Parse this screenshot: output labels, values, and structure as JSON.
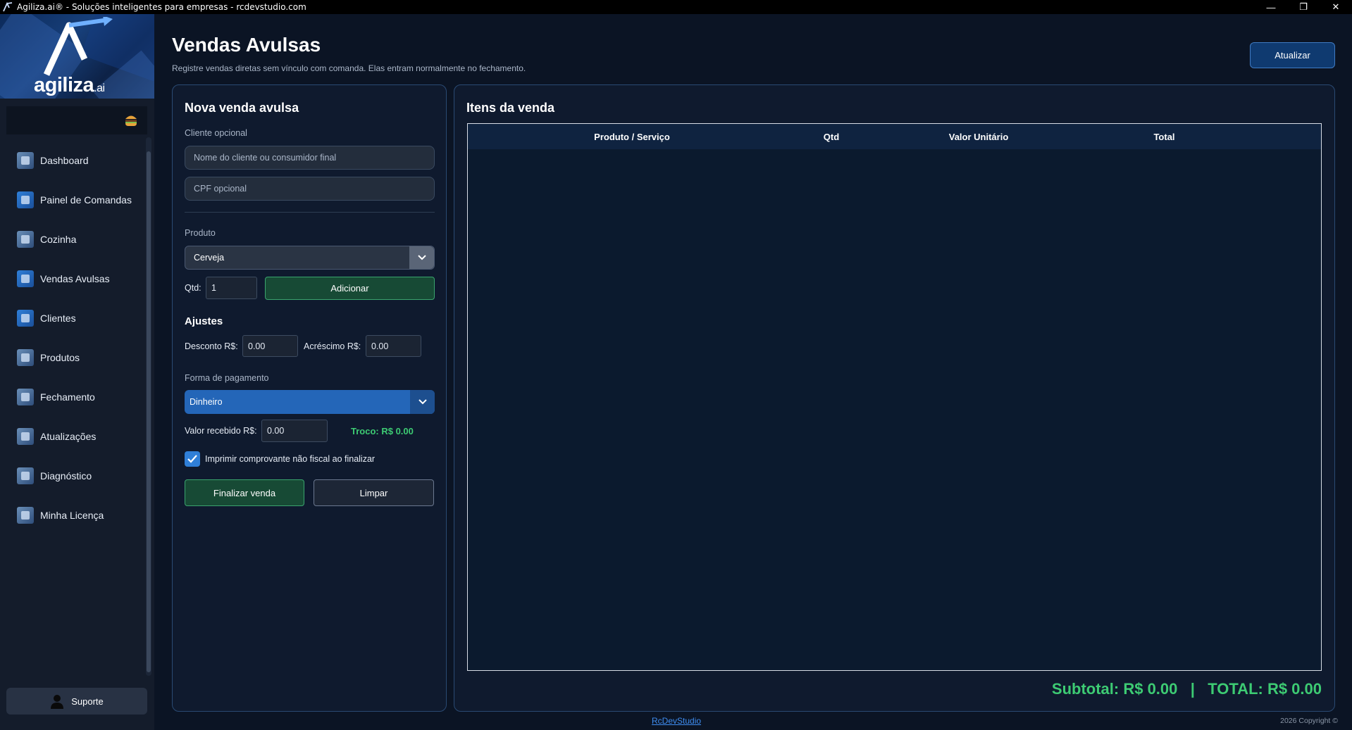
{
  "window": {
    "title": "Agiliza.ai® - Soluções inteligentes para empresas - rcdevstudio.com",
    "controls": {
      "minimize": "—",
      "restore": "❐",
      "close": "✕"
    }
  },
  "sidebar": {
    "logo_text": "agiliza",
    "logo_suffix": ".ai",
    "items": [
      {
        "label": "Dashboard",
        "icon": "dashboard-icon"
      },
      {
        "label": "Painel de Comandas",
        "icon": "orders-panel-icon"
      },
      {
        "label": "Cozinha",
        "icon": "kitchen-icon"
      },
      {
        "label": "Vendas Avulsas",
        "icon": "sales-icon"
      },
      {
        "label": "Clientes",
        "icon": "clients-icon"
      },
      {
        "label": "Produtos",
        "icon": "products-icon"
      },
      {
        "label": "Fechamento",
        "icon": "closing-icon"
      },
      {
        "label": "Atualizações",
        "icon": "updates-icon"
      },
      {
        "label": "Diagnóstico",
        "icon": "diagnostics-icon"
      },
      {
        "label": "Minha Licença",
        "icon": "license-icon"
      }
    ],
    "support_label": "Suporte"
  },
  "header": {
    "title": "Vendas Avulsas",
    "subtitle": "Registre vendas diretas sem vínculo com comanda. Elas entram normalmente no fechamento.",
    "refresh_label": "Atualizar"
  },
  "form": {
    "heading": "Nova venda avulsa",
    "client_label": "Cliente opcional",
    "client_placeholder": "Nome do cliente ou consumidor final",
    "cpf_placeholder": "CPF opcional",
    "product_label": "Produto",
    "product_value": "Cerveja",
    "qty_label": "Qtd:",
    "qty_value": "1",
    "add_label": "Adicionar",
    "adjust_heading": "Ajustes",
    "discount_label": "Desconto R$:",
    "discount_value": "0.00",
    "surcharge_label": "Acréscimo R$:",
    "surcharge_value": "0.00",
    "payment_label": "Forma de pagamento",
    "payment_value": "Dinheiro",
    "received_label": "Valor recebido R$:",
    "received_value": "0.00",
    "change_text": "Troco: R$ 0.00",
    "print_label": "Imprimir comprovante não fiscal ao finalizar",
    "print_checked": true,
    "finish_label": "Finalizar venda",
    "clear_label": "Limpar"
  },
  "items": {
    "heading": "Itens da venda",
    "columns": [
      "Produto / Serviço",
      "Qtd",
      "Valor Unitário",
      "Total"
    ],
    "rows": [],
    "totals_text": "Subtotal: R$ 0.00   |   TOTAL: R$ 0.00"
  },
  "footer": {
    "link": "RcDevStudio",
    "copyright": "2026 Copyright ©"
  },
  "colors": {
    "accent_green": "#3dcb73",
    "accent_blue": "#2f7fd8",
    "background": "#0b1424"
  }
}
